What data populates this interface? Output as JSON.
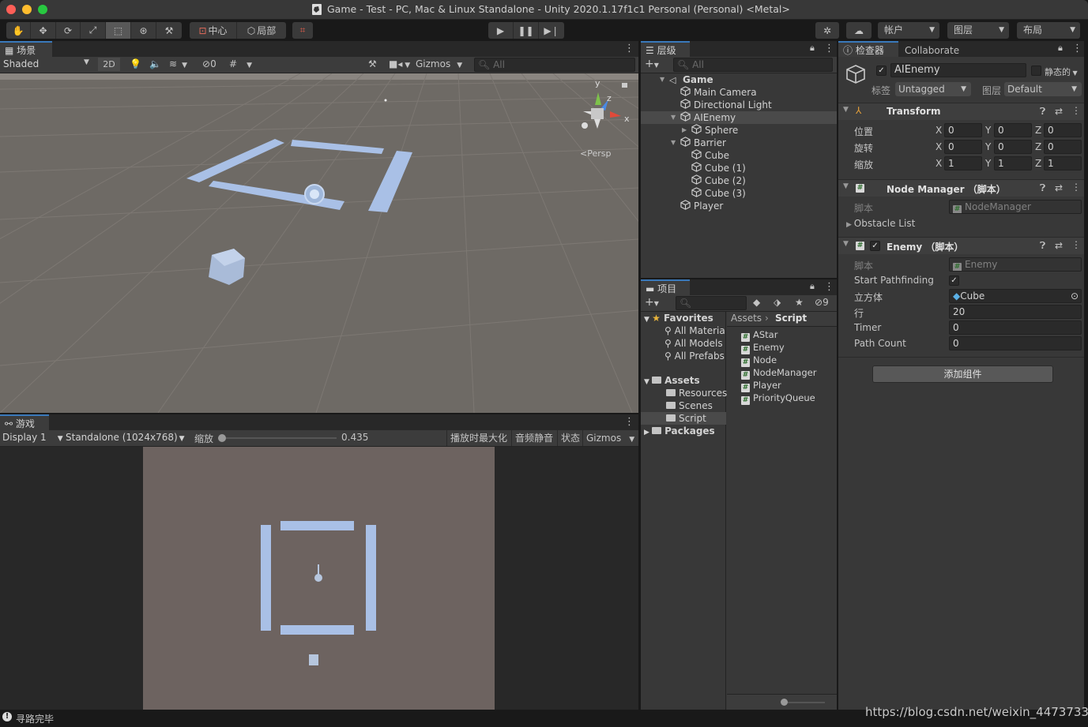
{
  "window": {
    "title": "Game - Test - PC, Mac & Linux Standalone - Unity 2020.1.17f1c1 Personal (Personal) <Metal>"
  },
  "toolbar": {
    "pivot_label": "中心",
    "space_label": "局部",
    "account_label": "帐户",
    "layers_label": "图层",
    "layout_label": "布局"
  },
  "scene": {
    "tab_label": "场景",
    "shading": "Shaded",
    "mode_2d": "2D",
    "hidden_count": "0",
    "gizmos": "Gizmos",
    "search_placeholder": "All",
    "persp_label": "Persp",
    "axis_y": "y",
    "axis_z": "z",
    "axis_x": "x"
  },
  "game": {
    "tab_label": "游戏",
    "display": "Display 1",
    "resolution": "Standalone (1024x768)",
    "scale_label": "缩放",
    "scale_value": "0.435",
    "scale_fraction": 0.435,
    "maximize": "播放时最大化",
    "mute": "音频静音",
    "stats": "状态",
    "gizmos": "Gizmos"
  },
  "hierarchy": {
    "tab_label": "层级",
    "search_placeholder": "All",
    "items": [
      {
        "label": "Game",
        "depth": 0,
        "arrow": "▼",
        "icon": "unity-scene-icon",
        "bold": true
      },
      {
        "label": "Main Camera",
        "depth": 1,
        "arrow": "",
        "icon": "cube-icon"
      },
      {
        "label": "Directional Light",
        "depth": 1,
        "arrow": "",
        "icon": "cube-icon"
      },
      {
        "label": "AIEnemy",
        "depth": 1,
        "arrow": "▼",
        "icon": "cube-icon",
        "selected": true
      },
      {
        "label": "Sphere",
        "depth": 2,
        "arrow": "▶",
        "icon": "cube-icon"
      },
      {
        "label": "Barrier",
        "depth": 1,
        "arrow": "▼",
        "icon": "cube-icon"
      },
      {
        "label": "Cube",
        "depth": 2,
        "arrow": "",
        "icon": "cube-icon"
      },
      {
        "label": "Cube (1)",
        "depth": 2,
        "arrow": "",
        "icon": "cube-icon"
      },
      {
        "label": "Cube (2)",
        "depth": 2,
        "arrow": "",
        "icon": "cube-icon"
      },
      {
        "label": "Cube (3)",
        "depth": 2,
        "arrow": "",
        "icon": "cube-icon"
      },
      {
        "label": "Player",
        "depth": 1,
        "arrow": "",
        "icon": "cube-icon"
      }
    ]
  },
  "project": {
    "tab_label": "项目",
    "hidden_count": "9",
    "favorites_label": "Favorites",
    "favorites": [
      "All Materia",
      "All Models",
      "All Prefabs"
    ],
    "assets_label": "Assets",
    "asset_folders": [
      "Resources",
      "Scenes",
      "Script"
    ],
    "packages_label": "Packages",
    "breadcrumb": [
      "Assets",
      "Script"
    ],
    "files": [
      "AStar",
      "Enemy",
      "Node",
      "NodeManager",
      "Player",
      "PriorityQueue"
    ]
  },
  "inspector": {
    "tab_label": "检查器",
    "collab_label": "Collaborate",
    "object_name": "AIEnemy",
    "static_label": "静态的",
    "tag_label": "标签",
    "tag_value": "Untagged",
    "layer_label": "图层",
    "layer_value": "Default",
    "transform": {
      "title": "Transform",
      "rows": [
        {
          "label": "位置",
          "x": "0",
          "y": "0",
          "z": "0"
        },
        {
          "label": "旋转",
          "x": "0",
          "y": "0",
          "z": "0"
        },
        {
          "label": "缩放",
          "x": "1",
          "y": "1",
          "z": "1"
        }
      ]
    },
    "node_manager": {
      "title": "Node Manager （脚本）",
      "script_label": "脚本",
      "script_value": "NodeManager",
      "obstacle_label": "Obstacle List"
    },
    "enemy": {
      "title": "Enemy （脚本）",
      "script_label": "脚本",
      "script_value": "Enemy",
      "start_label": "Start Pathfinding",
      "cube_label": "立方体",
      "cube_value": "Cube",
      "rows_label": "行",
      "rows_value": "20",
      "timer_label": "Timer",
      "timer_value": "0",
      "path_label": "Path Count",
      "path_value": "0"
    },
    "add_component": "添加组件"
  },
  "status": {
    "text": "寻路完毕",
    "watermark": "https://blog.csdn.net/weixin_44737332"
  },
  "colors": {
    "accent": "#3a79bb",
    "selection": "#4a4a4a",
    "ground": "#6e6a65",
    "wall": "#a9c0e6",
    "game_bg": "#6d6360"
  }
}
